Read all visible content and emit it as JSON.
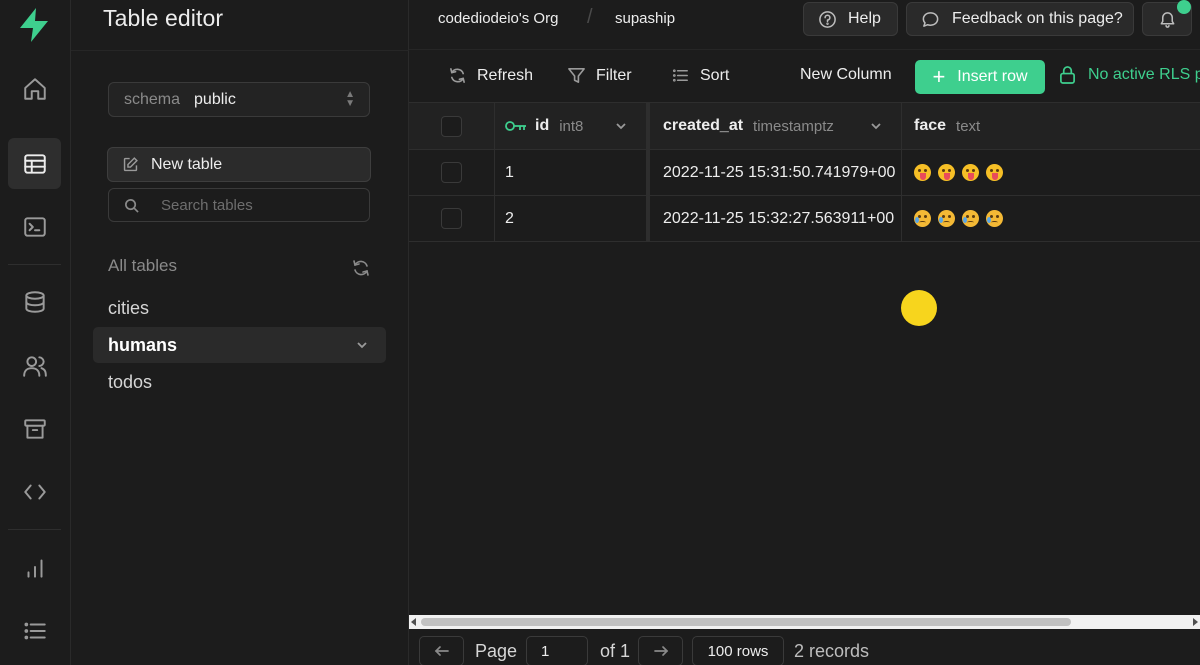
{
  "panel": {
    "title": "Table editor",
    "schema_label": "schema",
    "schema_value": "public",
    "new_table_label": "New table",
    "search_placeholder": "Search tables",
    "all_tables_label": "All tables",
    "tables": [
      {
        "name": "cities",
        "active": false
      },
      {
        "name": "humans",
        "active": true
      },
      {
        "name": "todos",
        "active": false
      }
    ]
  },
  "topbar": {
    "org": "codediodeio's Org",
    "project": "supaship",
    "help_label": "Help",
    "feedback_label": "Feedback on this page?"
  },
  "toolbar": {
    "refresh_label": "Refresh",
    "filter_label": "Filter",
    "sort_label": "Sort",
    "new_column_label": "New Column",
    "insert_row_label": "Insert row",
    "rls_label": "No active RLS p"
  },
  "grid": {
    "columns": [
      {
        "name": "id",
        "type": "int8",
        "primary_key": true
      },
      {
        "name": "created_at",
        "type": "timestamptz"
      },
      {
        "name": "face",
        "type": "text"
      }
    ],
    "rows": [
      {
        "id": "1",
        "created_at": "2022-11-25 15:31:50.741979+00",
        "face": [
          "tongue-face",
          "tongue-face",
          "tongue-face",
          "tongue-face"
        ]
      },
      {
        "id": "2",
        "created_at": "2022-11-25 15:32:27.563911+00",
        "face": [
          "sad-tear-face",
          "sad-tear-face",
          "sad-tear-face",
          "sad-tear-face"
        ]
      }
    ]
  },
  "footer": {
    "page_label": "Page",
    "page_value": "1",
    "of_label": "of 1",
    "rows_label": "100 rows",
    "records_label": "2 records"
  },
  "colors": {
    "brand": "#3ecf8e",
    "background": "#1c1c1c",
    "cursor_highlight": "#f7d51d"
  }
}
